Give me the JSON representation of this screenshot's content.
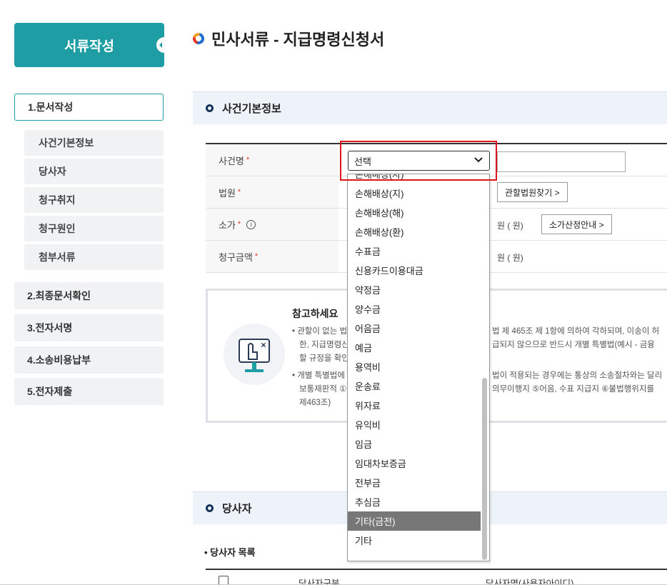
{
  "sidebar": {
    "header": "서류작성",
    "steps": [
      {
        "label": "1.문서작성"
      },
      {
        "label": "2.최종문서확인"
      },
      {
        "label": "3.전자서명"
      },
      {
        "label": "4.소송비용납부"
      },
      {
        "label": "5.전자제출"
      }
    ],
    "subitems": [
      {
        "label": "사건기본정보"
      },
      {
        "label": "당사자"
      },
      {
        "label": "청구취지"
      },
      {
        "label": "청구원인"
      },
      {
        "label": "첨부서류"
      }
    ]
  },
  "page": {
    "title": "민사서류 - 지급명령신청서"
  },
  "basic_section": {
    "title": "사건기본정보",
    "rows": [
      {
        "label": "사건명",
        "required_mark": "*"
      },
      {
        "label": "법원",
        "required_mark": "*"
      },
      {
        "label": "소가",
        "required_mark": "*"
      },
      {
        "label": "청구금액",
        "required_mark": "*"
      }
    ],
    "info_icon": "i",
    "court_button": "관할법원찾기 >",
    "value_button": "소가산정안내 >",
    "unit_label": "원 ( 원)"
  },
  "select": {
    "value": "선택",
    "options": [
      "손해배상(자)",
      "손해배상(지)",
      "손해배상(해)",
      "손해배상(환)",
      "수표금",
      "신용카드이용대금",
      "약정금",
      "양수금",
      "어음금",
      "예금",
      "용역비",
      "운송료",
      "위자료",
      "유익비",
      "임금",
      "임대차보증금",
      "전부금",
      "추심금",
      "기타(금전)",
      "기타"
    ],
    "highlighted": "기타(금전)"
  },
  "notice": {
    "title": "참고하세요",
    "lines": [
      {
        "text": "• 관할이 없는 법"
      },
      {
        "text": "한, 지급명령신"
      },
      {
        "text": "할 규정을 확인"
      },
      {
        "text": "• 개별 특별법에"
      },
      {
        "text": "보통재판적 ①"
      },
      {
        "text": "제463조)"
      }
    ],
    "right_lines": [
      {
        "text": "법 제 465조 제 1항에 의하여 각하되며, 이송이 허"
      },
      {
        "text": "급되지 않으므로 반드시 개별 특별법(예시 - 금융"
      },
      {
        "text": "법이 적용되는 경우에는 통상의 소송절차와는 달리"
      },
      {
        "text": "의무이행지 ⑤어음, 수표 지급지 ⑥불법행위지를"
      }
    ]
  },
  "party_section": {
    "title": "당사자",
    "list_title": "• 당사자 목록",
    "columns": [
      "당사자구분",
      "당사자명(사용자아이디)"
    ]
  }
}
